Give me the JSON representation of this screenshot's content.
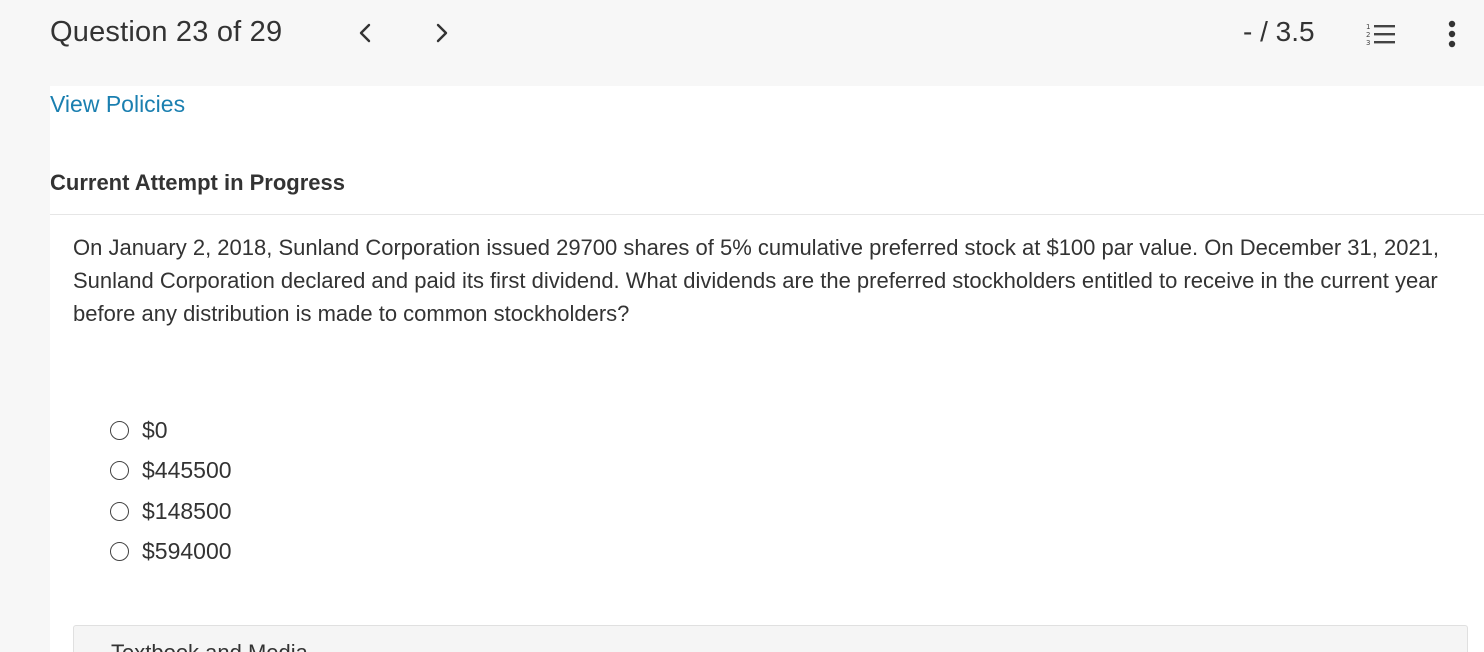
{
  "header": {
    "question_counter": "Question 23 of 29",
    "prev_icon": "chevron-left-icon",
    "next_icon": "chevron-right-icon",
    "score": "- / 3.5",
    "list_icon": "numbered-list-icon",
    "more_icon": "vertical-ellipsis-icon"
  },
  "links": {
    "view_policies": "View Policies"
  },
  "attempt": {
    "label": "Current Attempt in Progress"
  },
  "question": {
    "text": "On January 2, 2018, Sunland Corporation issued 29700 shares of 5% cumulative preferred stock at $100 par value. On December 31, 2021, Sunland Corporation declared and paid its first dividend. What dividends are the preferred stockholders entitled to receive in the current year before any distribution is made to common stockholders?"
  },
  "options": [
    {
      "label": "$0"
    },
    {
      "label": "$445500"
    },
    {
      "label": "$148500"
    },
    {
      "label": "$594000"
    }
  ],
  "bottom": {
    "label": "Textbook and Media"
  },
  "colors": {
    "link": "#1a7fb0",
    "header_bg": "#f7f7f7"
  }
}
